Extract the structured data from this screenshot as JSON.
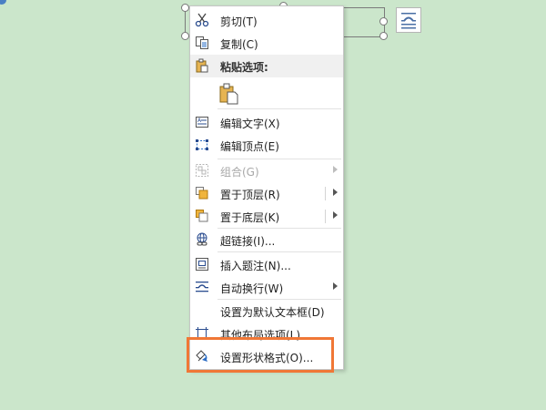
{
  "menu": {
    "cut": "剪切(T)",
    "copy": "复制(C)",
    "paste_options": "粘贴选项:",
    "edit_text": "编辑文字(X)",
    "edit_points": "编辑顶点(E)",
    "group": "组合(G)",
    "bring_to_front": "置于顶层(R)",
    "send_to_back": "置于底层(K)",
    "hyperlink": "超链接(I)...",
    "insert_caption": "插入题注(N)...",
    "wrap_text": "自动换行(W)",
    "set_default_textbox": "设置为默认文本框(D)",
    "more_layout": "其他布局选项(L)...",
    "format_shape": "设置形状格式(O)..."
  },
  "colors": {
    "background": "#cbe6cb",
    "highlight": "#f07736"
  }
}
